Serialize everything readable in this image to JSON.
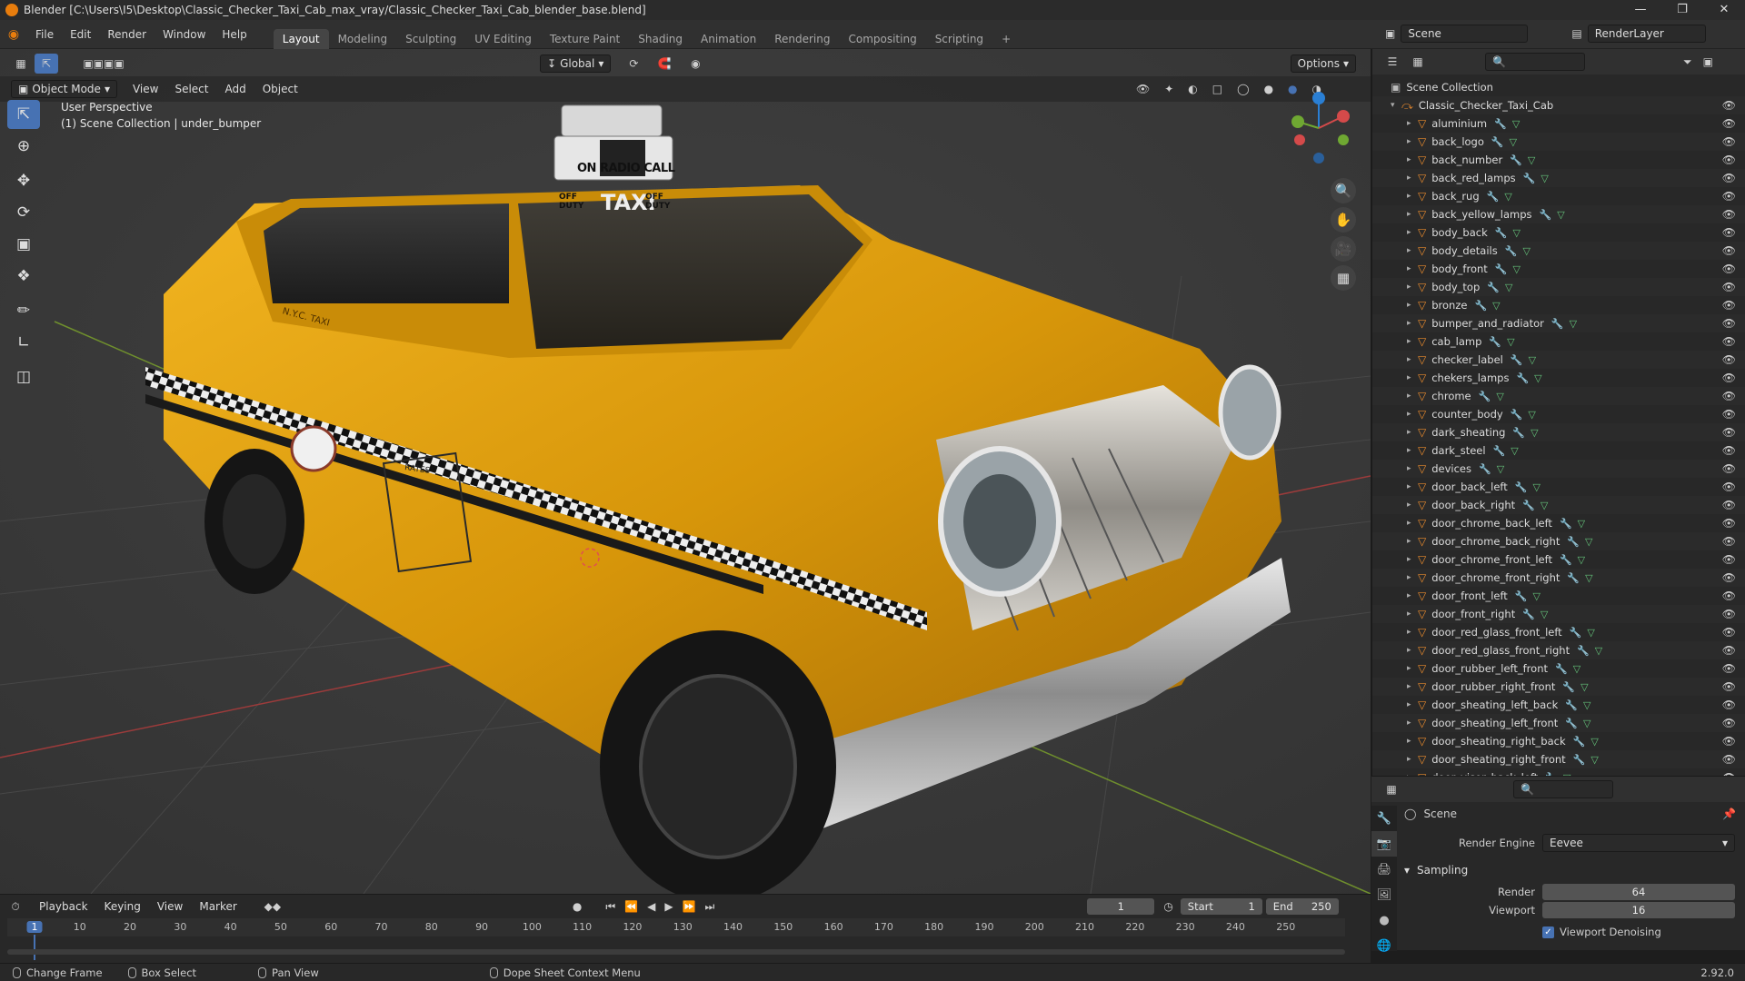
{
  "window": {
    "title": "Blender [C:\\Users\\I5\\Desktop\\Classic_Checker_Taxi_Cab_max_vray/Classic_Checker_Taxi_Cab_blender_base.blend]"
  },
  "menu": [
    "File",
    "Edit",
    "Render",
    "Window",
    "Help"
  ],
  "workspaces": [
    {
      "label": "Layout",
      "active": true
    },
    {
      "label": "Modeling"
    },
    {
      "label": "Sculpting"
    },
    {
      "label": "UV Editing"
    },
    {
      "label": "Texture Paint"
    },
    {
      "label": "Shading"
    },
    {
      "label": "Animation"
    },
    {
      "label": "Rendering"
    },
    {
      "label": "Compositing"
    },
    {
      "label": "Scripting"
    }
  ],
  "scene": {
    "name": "Scene",
    "view_layer": "RenderLayer"
  },
  "toolheader": {
    "orientation": "Global",
    "options": "Options"
  },
  "viewport": {
    "mode": "Object Mode",
    "menus": [
      "View",
      "Select",
      "Add",
      "Object"
    ],
    "perspective": "User Perspective",
    "context": "(1) Scene Collection | under_bumper",
    "taxi_sign_top": "ON RADIO CALL",
    "taxi_sign_main": "TAXI",
    "taxi_sign_left": "OFF DUTY",
    "taxi_sign_right": "OFF DUTY",
    "door_text": "N.Y.C. TAXI",
    "rates_heading": "RATES"
  },
  "outliner": {
    "root": "Scene Collection",
    "collection": "Classic_Checker_Taxi_Cab",
    "objects": [
      "aluminium",
      "back_logo",
      "back_number",
      "back_red_lamps",
      "back_rug",
      "back_yellow_lamps",
      "body_back",
      "body_details",
      "body_front",
      "body_top",
      "bronze",
      "bumper_and_radiator",
      "cab_lamp",
      "checker_label",
      "chekers_lamps",
      "chrome",
      "counter_body",
      "dark_sheating",
      "dark_steel",
      "devices",
      "door_back_left",
      "door_back_right",
      "door_chrome_back_left",
      "door_chrome_back_right",
      "door_chrome_front_left",
      "door_chrome_front_right",
      "door_front_left",
      "door_front_right",
      "door_red_glass_front_left",
      "door_red_glass_front_right",
      "door_rubber_left_front",
      "door_rubber_right_front",
      "door_sheating_left_back",
      "door_sheating_left_front",
      "door_sheating_right_back",
      "door_sheating_right_front",
      "door_visor_back_left"
    ]
  },
  "properties": {
    "context": "Scene",
    "render_engine_label": "Render Engine",
    "render_engine": "Eevee",
    "sampling_label": "Sampling",
    "render_label": "Render",
    "render_samples": "64",
    "viewport_label": "Viewport",
    "viewport_samples": "16",
    "denoise_label": "Viewport Denoising",
    "denoise_checked": true
  },
  "timeline": {
    "menus": [
      "Playback",
      "Keying",
      "View",
      "Marker"
    ],
    "current_frame": "1",
    "start_label": "Start",
    "start": "1",
    "end_label": "End",
    "end": "250",
    "ruler_labels": [
      "1",
      "10",
      "20",
      "30",
      "40",
      "50",
      "60",
      "70",
      "80",
      "90",
      "100",
      "110",
      "120",
      "130",
      "140",
      "150",
      "160",
      "170",
      "180",
      "190",
      "200",
      "210",
      "220",
      "230",
      "240",
      "250"
    ]
  },
  "statusbar": {
    "items": [
      "Change Frame",
      "Box Select",
      "Pan View",
      "Dope Sheet Context Menu"
    ],
    "version": "2.92.0"
  },
  "colors": {
    "accent": "#4772b3",
    "taxi_yellow": "#e1a20b",
    "mesh_orange": "#e88a2d"
  }
}
